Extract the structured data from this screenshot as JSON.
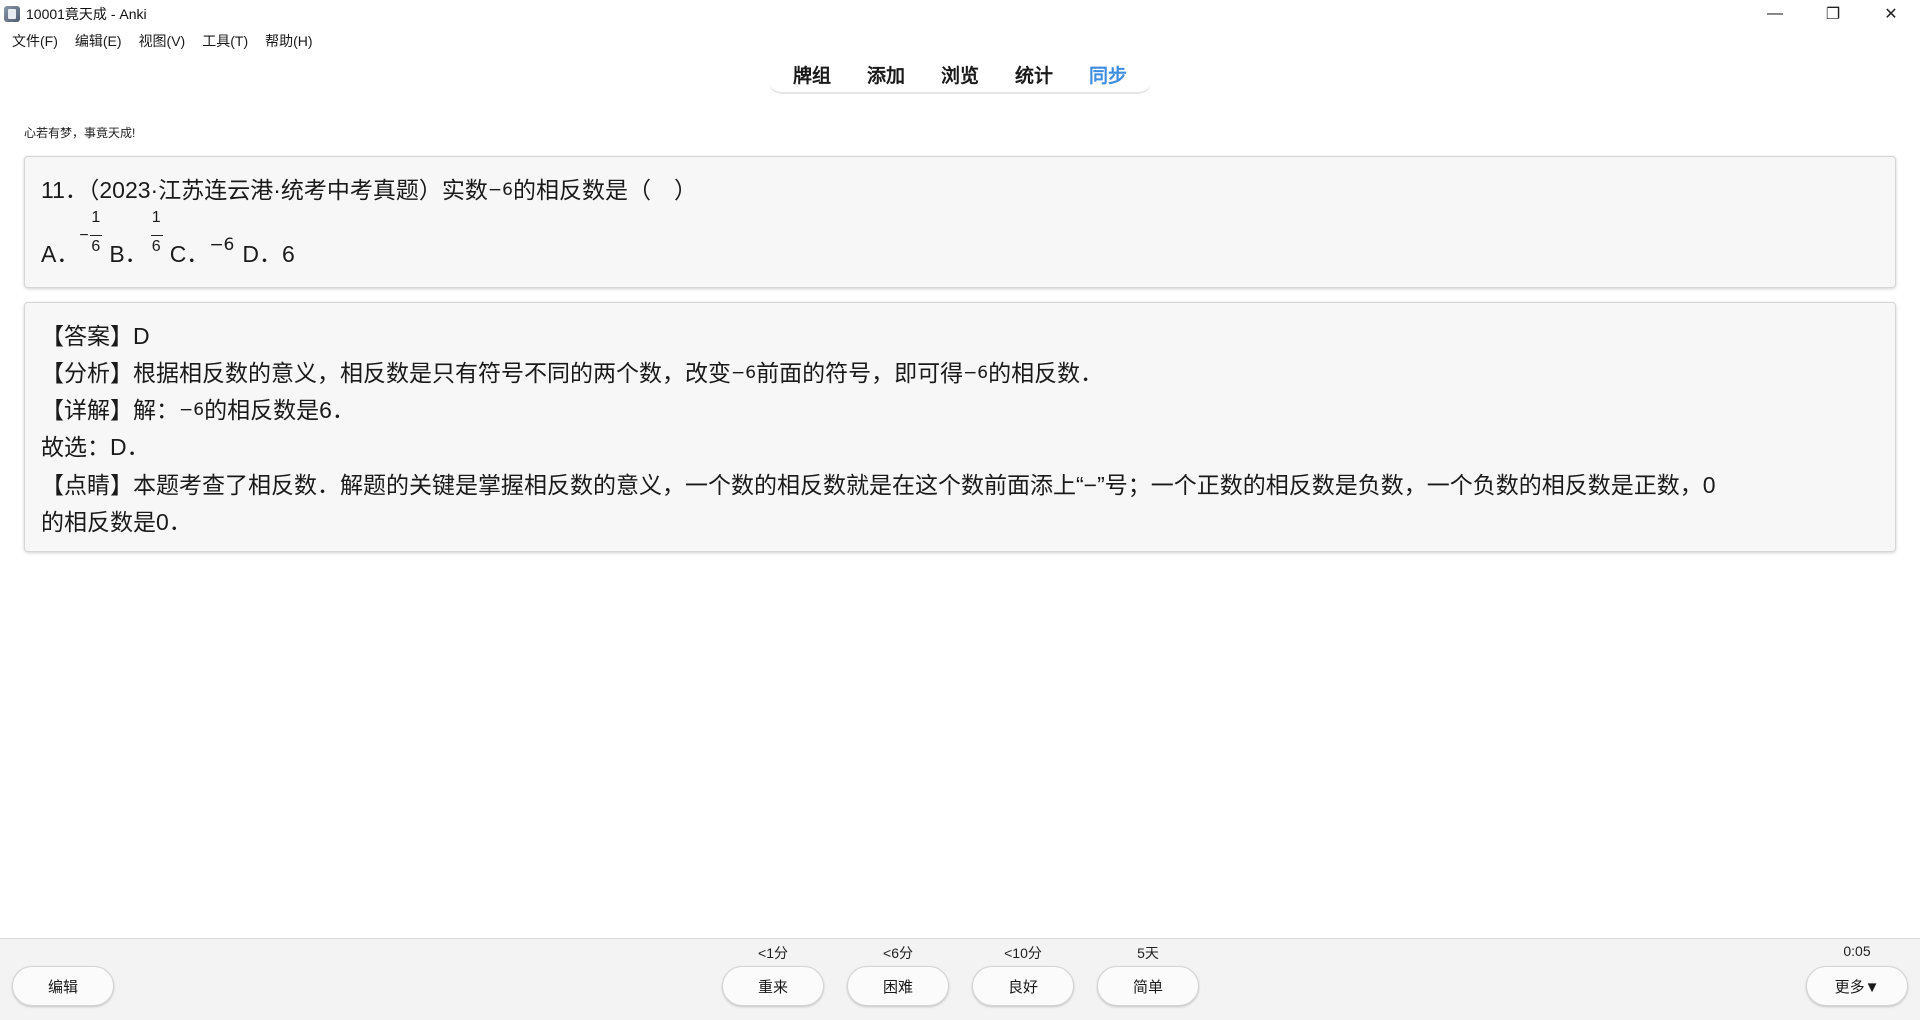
{
  "window": {
    "title": "10001竟天成 - Anki",
    "controls": [
      "minimize-icon",
      "restore-icon",
      "close-icon"
    ]
  },
  "menu": [
    "文件(F)",
    "编辑(E)",
    "视图(V)",
    "工具(T)",
    "帮助(H)"
  ],
  "nav": {
    "items": [
      "牌组",
      "添加",
      "浏览",
      "统计",
      "同步"
    ],
    "active": "同步",
    "active_color": "#3d8de0"
  },
  "motto": "心若有梦，事竟天成!",
  "question": {
    "stem": "11．（2023·江苏连云港·统考中考真题）实数",
    "stem_math": "−6",
    "stem_end": "的相反数是（　）",
    "opt_a": "A．",
    "opt_a_sign": "−",
    "opt_a_num": "1",
    "opt_a_den": "6",
    "opt_b": "B．",
    "opt_b_num": "1",
    "opt_b_den": "6",
    "opt_c": "C．",
    "opt_c_math": "−6",
    "opt_d": "D．6"
  },
  "answer": {
    "line1": "【答案】D",
    "line2_a": "【分析】根据相反数的意义，相反数是只有符号不同的两个数，改变",
    "line2_m1": "−6",
    "line2_b": "前面的符号，即可得",
    "line2_m2": "−6",
    "line2_c": "的相反数．",
    "line3_a": "【详解】解：",
    "line3_m": "−6",
    "line3_b": "的相反数是6．",
    "line4": "故选：D．",
    "line5": "【点睛】本题考查了相反数．解题的关键是掌握相反数的意义，一个数的相反数就是在这个数前面添上“−”号；一个正数的相反数是负数，一个负数的相反数是正数，0",
    "line6": "的相反数是0．"
  },
  "bottom": {
    "edit": "编辑",
    "again_interval": "<1分",
    "again": "重来",
    "hard_interval": "<6分",
    "hard": "困难",
    "good_interval": "<10分",
    "good": "良好",
    "easy_interval": "5天",
    "easy": "简单",
    "timer": "0:05",
    "more": "更多▼"
  }
}
